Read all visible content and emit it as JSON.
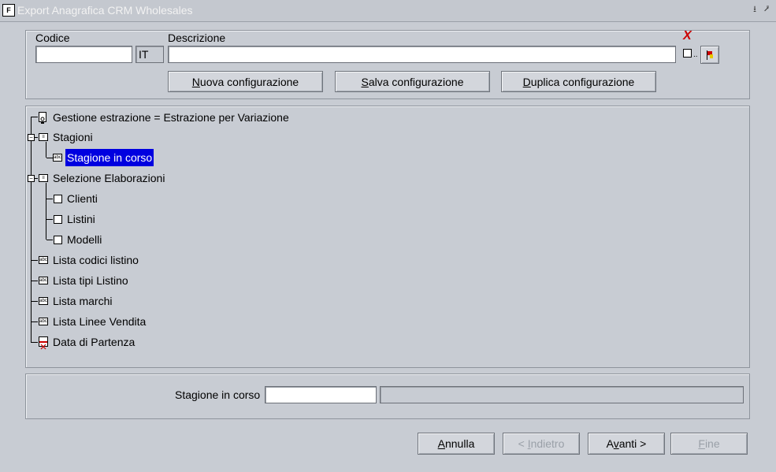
{
  "window": {
    "title": "Export Anagrafica CRM Wholesales",
    "app_icon": "oracle-forms-icon",
    "minimize_glyph": "⭳",
    "maximize_glyph": "⭷"
  },
  "header": {
    "codice_label": "Codice",
    "codice_value": "",
    "lang_value": "IT",
    "descrizione_label": "Descrizione",
    "descrizione_value": "",
    "flag_icon": "flag-icon",
    "delete_icon": "red-x-icon",
    "delete_glyph": "X",
    "checkbox_dots": ".."
  },
  "config_buttons": {
    "nuova_first": "N",
    "nuova_rest": "uova configurazione",
    "salva_first": "S",
    "salva_rest": "alva configurazione",
    "duplica_first": "D",
    "duplica_rest": "uplica configurazione"
  },
  "tree": {
    "items": [
      {
        "label": "Gestione estrazione = Estrazione per Variazione",
        "icon": "lock-icon"
      },
      {
        "label": "Stagioni",
        "icon": "list-icon"
      },
      {
        "label": "Stagione in corso",
        "icon": "abc-icon",
        "selected": true
      },
      {
        "label": "Selezione Elaborazioni",
        "icon": "list-icon"
      },
      {
        "label": "Clienti",
        "icon": "checkbox"
      },
      {
        "label": "Listini",
        "icon": "checkbox"
      },
      {
        "label": "Modelli",
        "icon": "checkbox"
      },
      {
        "label": "Lista codici listino",
        "icon": "abc-icon"
      },
      {
        "label": "Lista tipi Listino",
        "icon": "abc-icon"
      },
      {
        "label": "Lista marchi",
        "icon": "abc-icon"
      },
      {
        "label": "Lista Linee Vendita",
        "icon": "abc-icon"
      },
      {
        "label": "Data di Partenza",
        "icon": "calendar-icon"
      }
    ]
  },
  "detail": {
    "label": "Stagione in corso",
    "value": "",
    "extra_value": ""
  },
  "footer": {
    "annulla_first": "A",
    "annulla_rest": "nnulla",
    "indietro_prefix": "< ",
    "indietro_first": "I",
    "indietro_rest": "ndietro",
    "avanti_prefix": "A",
    "avanti_first": "v",
    "avanti_rest": "anti >",
    "fine_first": "F",
    "fine_rest": "ine"
  },
  "colors": {
    "background": "#c8ccd3",
    "selection": "#0000e0",
    "accent_red": "#cc0000"
  }
}
